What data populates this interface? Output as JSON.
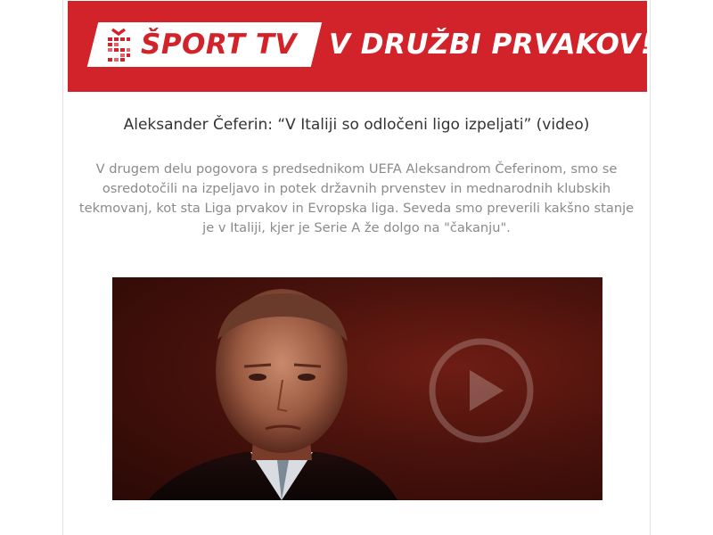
{
  "banner": {
    "logo_text": "ŠPORT TV",
    "slogan": "V DRUŽBI PRVAKOV!",
    "brand_color": "#d2232a"
  },
  "article": {
    "title": "Aleksander Čeferin: “V Italiji so odločeni ligo izpeljati” (video)",
    "lead": "V drugem delu pogovora s predsednikom UEFA Aleksandrom Čeferinom, smo se osredotočili na izpeljavo in potek državnih prvenstev in mednarodnih klubskih tekmovanj, kot sta Liga prvakov in Evropska liga. Seveda smo preverili kakšno stanje je v Italiji, kjer je Serie A že dolgo na \"čakanju\"."
  },
  "video": {
    "play_icon": "play-icon"
  }
}
